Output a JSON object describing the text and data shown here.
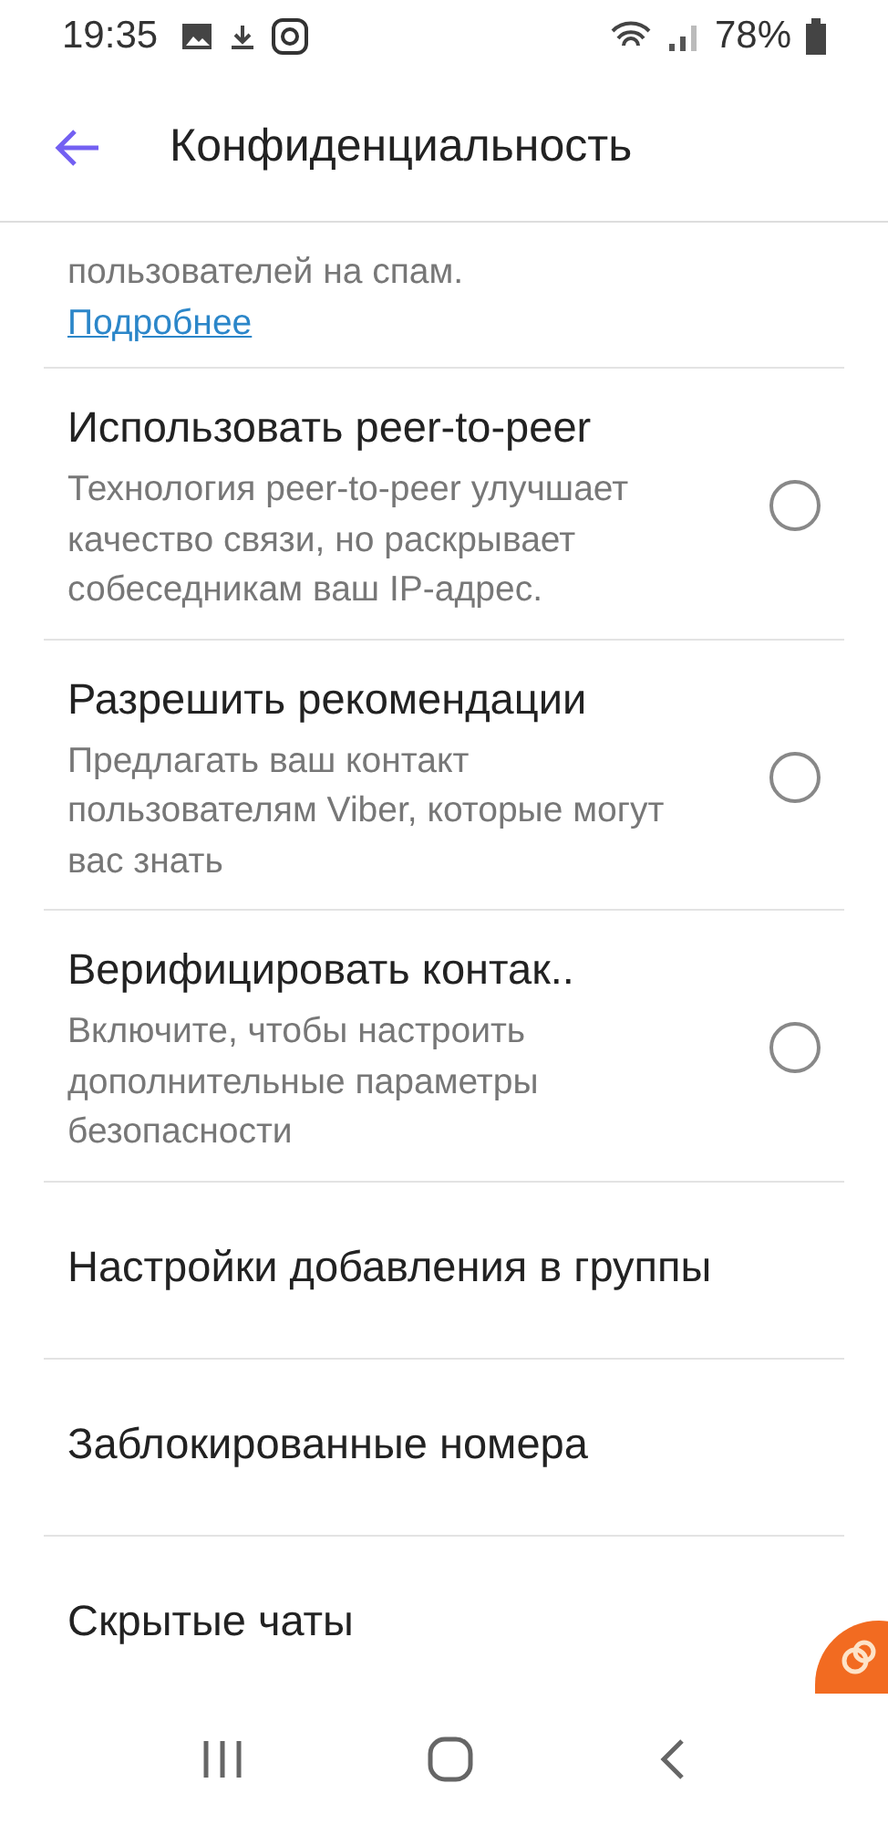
{
  "status_bar": {
    "time": "19:35",
    "battery": "78%"
  },
  "header": {
    "title": "Конфиденциальность"
  },
  "top_item": {
    "description_lines": [
      "пользователей на спам."
    ],
    "link": "Подробнее"
  },
  "items": [
    {
      "kind": "toggle",
      "title": "Использовать peer-to-peer",
      "description": "Технология peer-to-peer улучшает качество связи, но раскрывает собеседникам ваш IP-адрес.",
      "checked": false
    },
    {
      "kind": "toggle",
      "title": "Разрешить рекомендации",
      "description": "Предлагать ваш контакт пользователям Viber, которые могут вас знать",
      "checked": false
    },
    {
      "kind": "toggle",
      "title": "Верифицировать контак..",
      "description": "Включите, чтобы настроить дополнительные параметры безопасности",
      "checked": false
    },
    {
      "kind": "link",
      "title": "Настройки добавления в группы"
    },
    {
      "kind": "link",
      "title": "Заблокированные номера"
    },
    {
      "kind": "link",
      "title": "Скрытые чаты"
    }
  ]
}
